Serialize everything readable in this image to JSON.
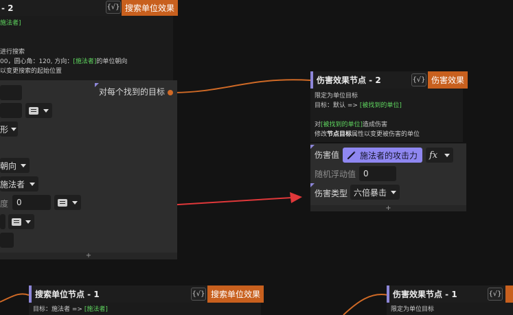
{
  "colors": {
    "canvas_bg": "#131313",
    "node_header": "#1d1d1d",
    "node_body": "#2d2d2d",
    "accent_purple": "#8d86d8",
    "chip_purple": "#8f87f1",
    "tag_orange": "#c8601e",
    "wire_orange": "#d06a26",
    "arrow_red": "#e0383a",
    "highlight_green": "#5fd65f"
  },
  "icons": {
    "validate": "check-bracket-icon",
    "list": "list-icon",
    "dropdown": "chevron-down-icon",
    "wand": "magic-wand-icon",
    "formula": "fx-icon"
  },
  "search_node_top": {
    "title": "- 2",
    "validate_label": "{√}",
    "tag": "搜索单位效果",
    "desc": {
      "l1_hl": "施法者]",
      "l2": "进行搜索",
      "l3a": "00，圆心角：120, 方向：",
      "l3_hl": "[施法者]",
      "l3b": "的单位朝向",
      "l4": "以变更搜索的起始位置"
    },
    "output_label": "对每个找到的目标",
    "row_direction_value": "朝向",
    "row_caster_value": "施法者",
    "row_shape_value": "形",
    "row_angle_label": "度",
    "row_angle_value": "0",
    "footer": "+"
  },
  "damage_node_2": {
    "title": "伤害效果节点 - 2",
    "validate_label": "{√}",
    "tag": "伤害效果",
    "desc": {
      "l1": "限定为单位目标",
      "l2a": "目标：默认 => ",
      "l2_hl": "[被找到的单位]",
      "l3a": "对",
      "l3_hl": "[被找到的单位]",
      "l3b": "造成伤害",
      "l4a": "修改",
      "l4_b": "节点目标",
      "l4b": "属性以变更被伤害的单位"
    },
    "damage_label": "伤害值",
    "damage_chip": "施法者的攻击力",
    "fx_label": "fx",
    "random_label": "随机浮动值",
    "random_value": "0",
    "type_label": "伤害类型",
    "type_value": "六倍暴击",
    "footer": "+"
  },
  "search_node_1": {
    "title": "搜索单位节点 - 1",
    "validate_label": "{√}",
    "tag": "搜索单位效果",
    "desc_a": "目标：施法者 => ",
    "desc_hl": "[施法者]"
  },
  "damage_node_1": {
    "title": "伤害效果节点 - 1",
    "validate_label": "{√}",
    "desc": "限定为单位目标"
  }
}
